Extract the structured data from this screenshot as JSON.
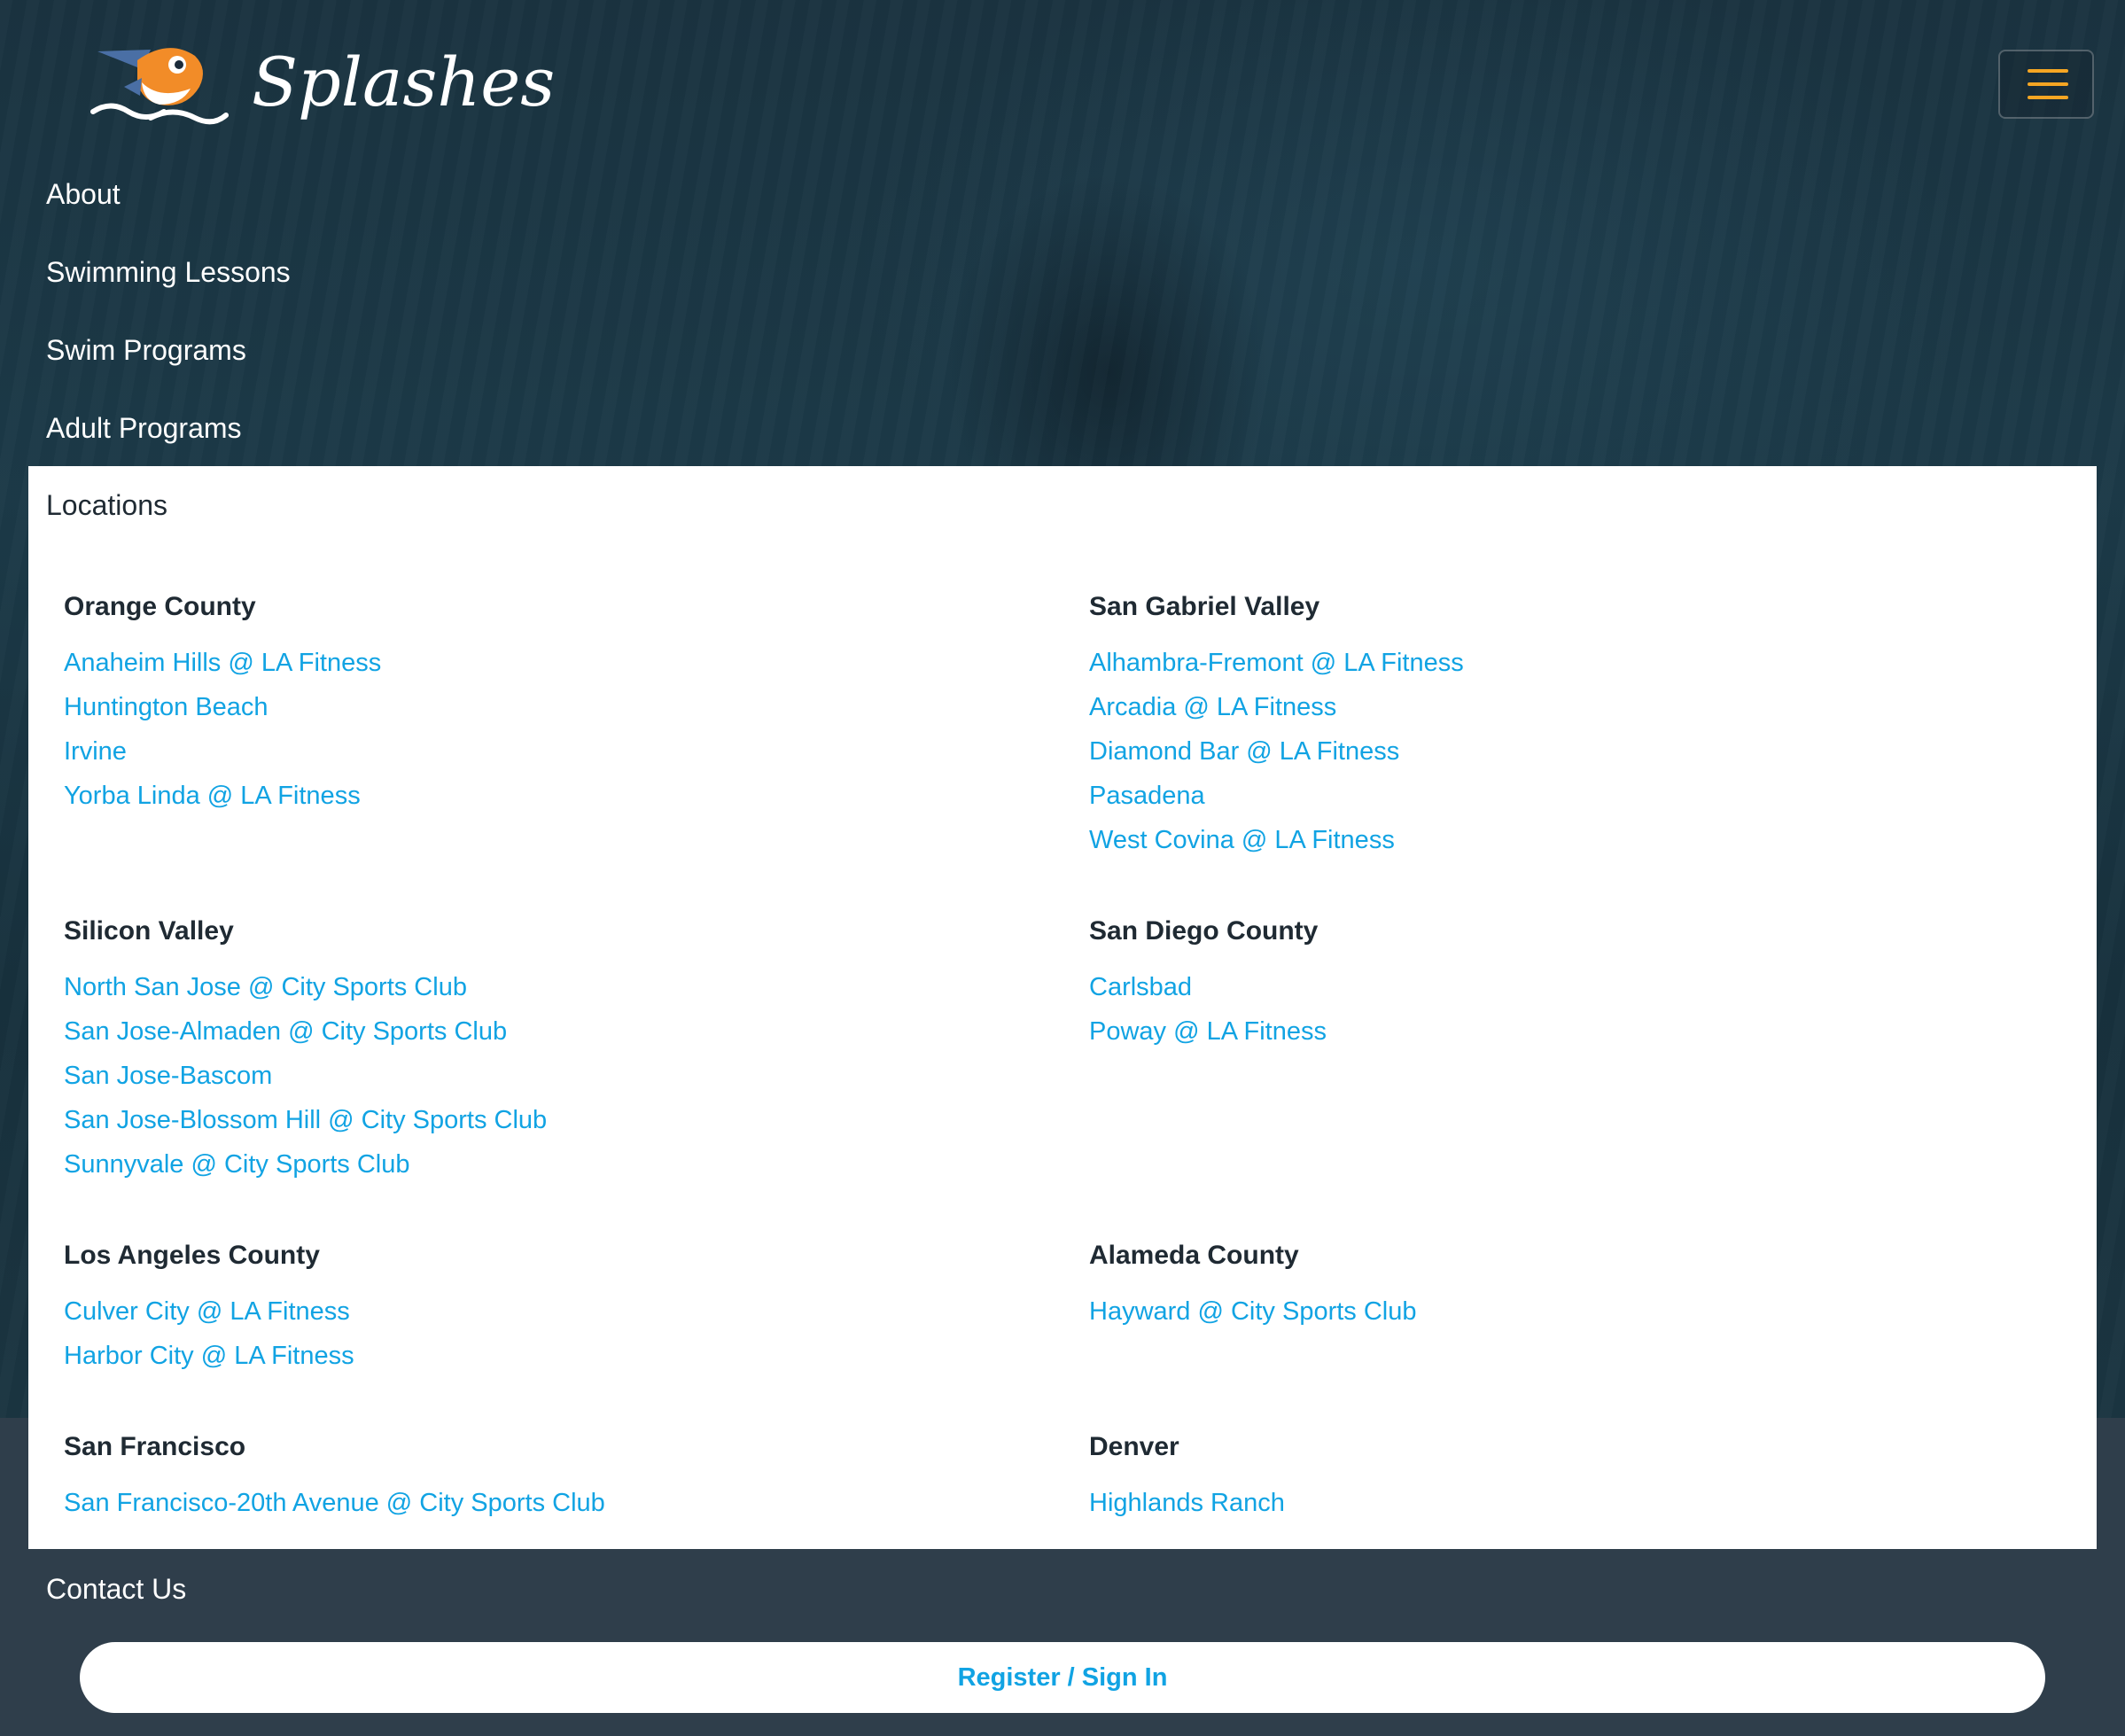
{
  "header": {
    "brand": "Splashes",
    "logo_icon": "shark-mascot-icon",
    "menu_icon": "hamburger-menu-icon",
    "colors": {
      "accent": "#f5a623",
      "link": "#11a3e3",
      "nav_bg": "#2f3e4b"
    }
  },
  "nav": {
    "about": "About",
    "swimming_lessons": "Swimming Lessons",
    "swim_programs": "Swim Programs",
    "adult_programs": "Adult Programs",
    "locations": "Locations",
    "contact": "Contact Us"
  },
  "regions": {
    "orange_county": {
      "name": "Orange County",
      "items": [
        "Anaheim Hills @ LA Fitness",
        "Huntington Beach",
        "Irvine",
        "Yorba Linda @ LA Fitness"
      ]
    },
    "san_gabriel_valley": {
      "name": "San Gabriel Valley",
      "items": [
        "Alhambra-Fremont @ LA Fitness",
        "Arcadia @ LA Fitness",
        "Diamond Bar @ LA Fitness",
        "Pasadena",
        "West Covina @ LA Fitness"
      ]
    },
    "silicon_valley": {
      "name": "Silicon Valley",
      "items": [
        "North San Jose @ City Sports Club",
        "San Jose-Almaden @ City Sports Club",
        "San Jose-Bascom",
        "San Jose-Blossom Hill @ City Sports Club",
        "Sunnyvale @ City Sports Club"
      ]
    },
    "san_diego_county": {
      "name": "San Diego County",
      "items": [
        "Carlsbad",
        "Poway @ LA Fitness"
      ]
    },
    "los_angeles_county": {
      "name": "Los Angeles County",
      "items": [
        "Culver City @ LA Fitness",
        "Harbor City @ LA Fitness"
      ]
    },
    "alameda_county": {
      "name": "Alameda County",
      "items": [
        "Hayward @ City Sports Club"
      ]
    },
    "san_francisco": {
      "name": "San Francisco",
      "items": [
        "San Francisco-20th Avenue @ City Sports Club"
      ]
    },
    "denver": {
      "name": "Denver",
      "items": [
        "Highlands Ranch"
      ]
    }
  },
  "register": {
    "label": "Register / Sign In"
  }
}
